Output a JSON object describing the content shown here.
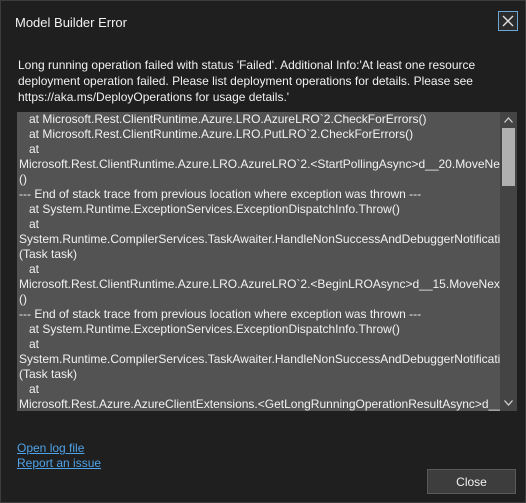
{
  "window": {
    "title": "Model Builder Error"
  },
  "message": {
    "text": "Long running operation failed with status 'Failed'. Additional Info:'At least one resource deployment operation failed. Please list deployment operations for details. Please see https://aka.ms/DeployOperations for usage details.'"
  },
  "trace": {
    "text": "   at Microsoft.Rest.ClientRuntime.Azure.LRO.AzureLRO`2.CheckForErrors()\n   at Microsoft.Rest.ClientRuntime.Azure.LRO.PutLRO`2.CheckForErrors()\n   at\nMicrosoft.Rest.ClientRuntime.Azure.LRO.AzureLRO`2.<StartPollingAsync>d__20.MoveNext\n()\n--- End of stack trace from previous location where exception was thrown ---\n   at System.Runtime.ExceptionServices.ExceptionDispatchInfo.Throw()\n   at\nSystem.Runtime.CompilerServices.TaskAwaiter.HandleNonSuccessAndDebuggerNotification\n(Task task)\n   at\nMicrosoft.Rest.ClientRuntime.Azure.LRO.AzureLRO`2.<BeginLROAsync>d__15.MoveNext\n()\n--- End of stack trace from previous location where exception was thrown ---\n   at System.Runtime.ExceptionServices.ExceptionDispatchInfo.Throw()\n   at\nSystem.Runtime.CompilerServices.TaskAwaiter.HandleNonSuccessAndDebuggerNotification\n(Task task)\n   at\nMicrosoft.Rest.Azure.AzureClientExtensions.<GetLongRunningOperationResultAsync>d__"
  },
  "links": {
    "open_log": "Open log file",
    "report_issue": "Report an issue"
  },
  "buttons": {
    "close": "Close"
  },
  "colors": {
    "background": "#1f1f1f",
    "trace_background": "#535353",
    "link": "#4fa3e8",
    "close_icon_border": "#6ea6d8"
  }
}
